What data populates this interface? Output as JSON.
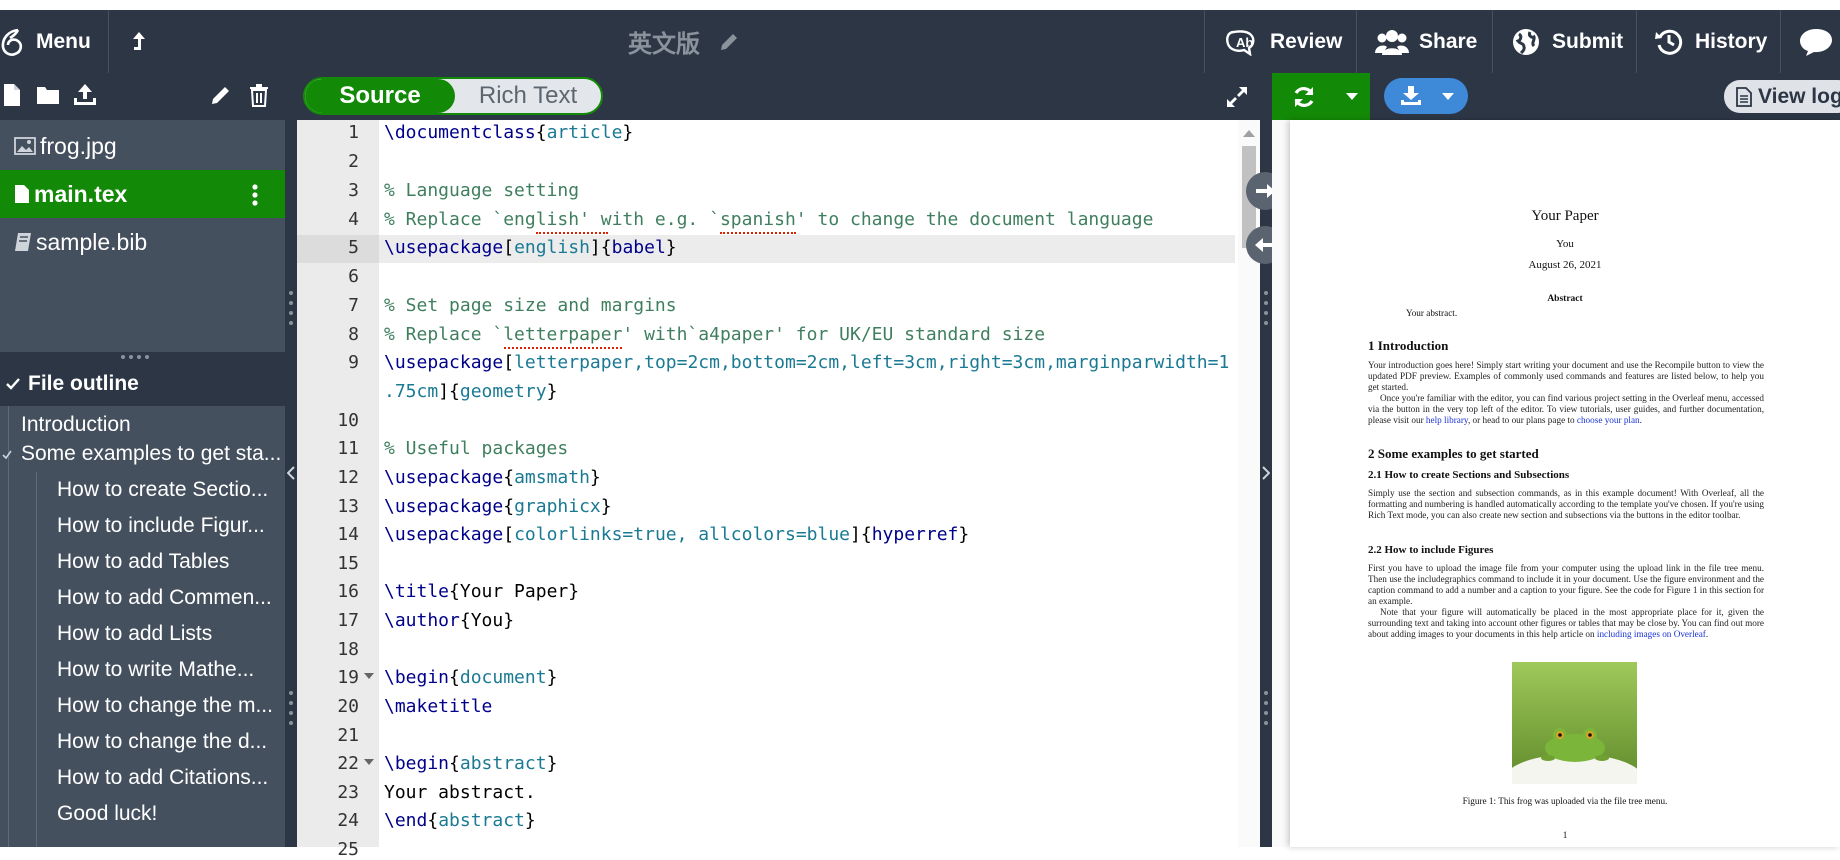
{
  "topbar": {
    "menu_label": "Menu",
    "project_title": "英文版",
    "review_label": "Review",
    "share_label": "Share",
    "submit_label": "Submit",
    "history_label": "History"
  },
  "editor_toggle": {
    "source_label": "Source",
    "rich_label": "Rich Text"
  },
  "pdf_toolbar": {
    "view_logs_label": "View log"
  },
  "files": [
    {
      "name": "frog.jpg",
      "type": "image"
    },
    {
      "name": "main.tex",
      "type": "tex",
      "active": true
    },
    {
      "name": "sample.bib",
      "type": "bib"
    }
  ],
  "outline": {
    "header": "File outline",
    "items": [
      {
        "label": "Introduction",
        "level": 1
      },
      {
        "label": "Some examples to get sta...",
        "level": 1,
        "expanded": true
      },
      {
        "label": "How to create Sectio...",
        "level": 2
      },
      {
        "label": "How to include Figur...",
        "level": 2
      },
      {
        "label": "How to add Tables",
        "level": 2
      },
      {
        "label": "How to add Commen...",
        "level": 2
      },
      {
        "label": "How to add Lists",
        "level": 2
      },
      {
        "label": "How to write Mathe...",
        "level": 2
      },
      {
        "label": "How to change the m...",
        "level": 2
      },
      {
        "label": "How to change the d...",
        "level": 2
      },
      {
        "label": "How to add Citations...",
        "level": 2
      },
      {
        "label": "Good luck!",
        "level": 2
      }
    ]
  },
  "code_lines": [
    "1",
    "2",
    "3",
    "4",
    "5",
    "6",
    "7",
    "8",
    "9",
    "",
    "10",
    "11",
    "12",
    "13",
    "14",
    "15",
    "16",
    "17",
    "18",
    "19",
    "20",
    "21",
    "22",
    "23",
    "24",
    "25"
  ],
  "code": {
    "l1": [
      "\\documentclass",
      "{",
      "article",
      "}"
    ],
    "l3": "% Language setting",
    "l4": "% Replace `english' with e.g. `spanish' to change the document language",
    "l5": [
      "\\usepackage",
      "[",
      "english",
      "]",
      "{",
      "babel",
      "}"
    ],
    "l7": "% Set page size and margins",
    "l8": "% Replace `letterpaper' with`a4paper' for UK/EU standard size",
    "l9a": [
      "\\usepackage",
      "[",
      "letterpaper,top=2cm,bottom=2cm,left=3cm,right=3cm,marginparwidth=1"
    ],
    "l9b": [
      ".75cm",
      "]",
      "{",
      "geometry",
      "}"
    ],
    "l11": "% Useful packages",
    "l12": [
      "\\usepackage",
      "{",
      "amsmath",
      "}"
    ],
    "l13": [
      "\\usepackage",
      "{",
      "graphicx",
      "}"
    ],
    "l14": [
      "\\usepackage",
      "[",
      "colorlinks=true, allcolors=blue",
      "]",
      "{",
      "hyperref",
      "}"
    ],
    "l16": [
      "\\title",
      "{Your Paper}"
    ],
    "l17": [
      "\\author",
      "{You}"
    ],
    "l19": [
      "\\begin",
      "{",
      "document",
      "}"
    ],
    "l20": "\\maketitle",
    "l22": [
      "\\begin",
      "{",
      "abstract",
      "}"
    ],
    "l23": "Your abstract.",
    "l24": [
      "\\end",
      "{",
      "abstract",
      "}"
    ]
  },
  "pdf": {
    "title": "Your Paper",
    "author": "You",
    "date": "August 26, 2021",
    "abstract_head": "Abstract",
    "abstract_text": "Your abstract.",
    "s1": "1   Introduction",
    "s1_p1": "Your introduction goes here! Simply start writing your document and use the Recompile button to view the updated PDF preview. Examples of commonly used commands and features are listed below, to help you get started.",
    "s1_p2a": "Once you're familiar with the editor, you can find various project setting in the Overleaf menu, accessed via the button in the very top left of the editor. To view tutorials, user guides, and further documentation, please visit our ",
    "s1_p2_link1": "help library",
    "s1_p2b": ", or head to our plans page to ",
    "s1_p2_link2": "choose your plan",
    "s1_p2c": ".",
    "s2": "2   Some examples to get started",
    "s21": "2.1   How to create Sections and Subsections",
    "s21_p": "Simply use the section and subsection commands, as in this example document! With Overleaf, all the formatting and numbering is handled automatically according to the template you've chosen. If you're using Rich Text mode, you can also create new section and subsections via the buttons in the editor toolbar.",
    "s22": "2.2   How to include Figures",
    "s22_p1": "First you have to upload the image file from your computer using the upload link in the file tree menu. Then use the includegraphics command to include it in your document. Use the figure environment and the caption command to add a number and a caption to your figure. See the code for Figure 1 in this section for an example.",
    "s22_p2a": "Note that your figure will automatically be placed in the most appropriate place for it, given the surrounding text and taking into account other figures or tables that may be close by. You can find out more about adding images to your documents in this help article on ",
    "s22_p2_link": "including images on Overleaf",
    "s22_p2b": ".",
    "caption": "Figure 1: This frog was uploaded via the file tree menu.",
    "page_no": "1"
  },
  "colors": {
    "accent_green": "#138a07",
    "toolbar_bg": "#2c3645",
    "sidebar_bg": "#45505e",
    "pdf_button_blue": "#3f8ad8"
  }
}
